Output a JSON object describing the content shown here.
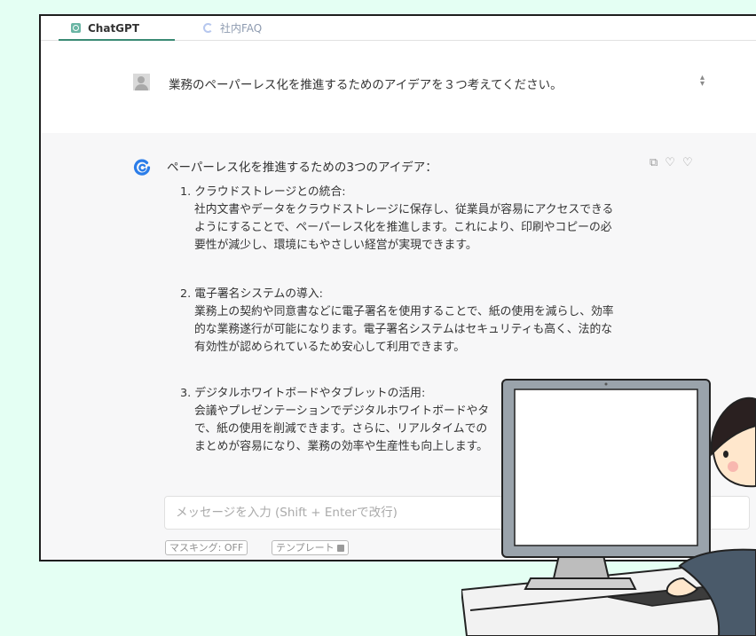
{
  "tabs": [
    {
      "label": "ChatGPT",
      "icon": "chatgpt-icon",
      "active": true
    },
    {
      "label": "社内FAQ",
      "icon": "faq-icon",
      "active": false
    }
  ],
  "user_message": {
    "avatar": "user-avatar",
    "text": "業務のペーパーレス化を推進するためのアイデアを３つ考えてください。"
  },
  "answer": {
    "title": "ペーパーレス化を推進するための3つのアイデア：",
    "items": [
      {
        "number": "1. クラウドストレージとの統合:",
        "lines": [
          "社内文書やデータをクラウドストレージに保存し、従業員が容易にアクセスできる",
          "ようにすることで、ペーパーレス化を推進します。これにより、印刷やコピーの必",
          "要性が減少し、環境にもやさしい経営が実現できます。"
        ]
      },
      {
        "number": "2. 電子署名システムの導入:",
        "lines": [
          "業務上の契約や同意書などに電子署名を使用することで、紙の使用を減らし、効率",
          "的な業務遂行が可能になります。電子署名システムはセキュリティも高く、法的な",
          "有効性が認められているため安心して利用できます。"
        ]
      },
      {
        "number": "3. デジタルホワイトボードやタブレットの活用:",
        "lines": [
          "会議やプレゼンテーションでデジタルホワイトボードやタ",
          "で、紙の使用を削減できます。さらに、リアルタイムでの",
          "まとめが容易になり、業務の効率や生産性も向上します。"
        ]
      }
    ],
    "tool_icons": [
      "copy-icon",
      "thumbs-up-icon",
      "thumbs-down-icon"
    ]
  },
  "composer": {
    "placeholder": "メッセージを入力 (Shift + Enterで改行)",
    "masking_label": "マスキング: OFF",
    "template_label": "テンプレート"
  },
  "colors": {
    "background": "#e4fff3",
    "accent": "#2b7de9",
    "active_tab": "#3a8a74"
  }
}
